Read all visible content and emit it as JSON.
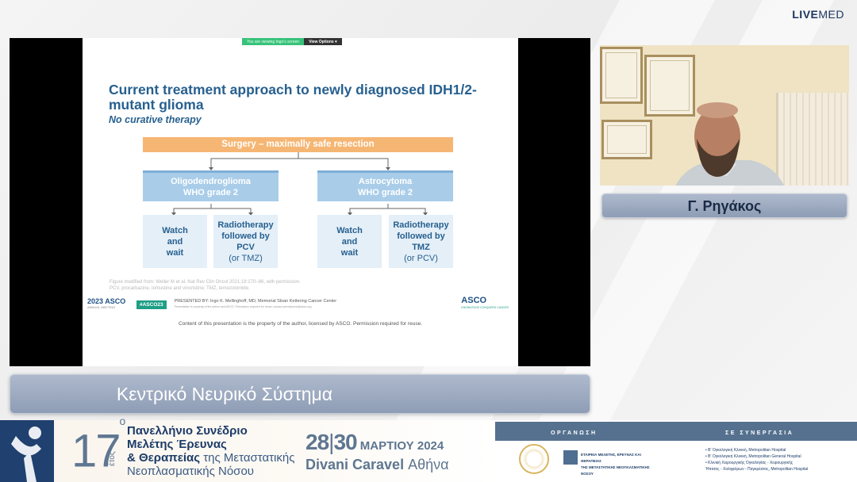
{
  "brand": {
    "live": "LIVE",
    "med": "MED"
  },
  "slide": {
    "viewing_notice": "You are viewing Ingo's screen",
    "view_options": "View Options ▾",
    "title": "Current treatment approach to newly diagnosed IDH1/2-mutant glioma",
    "subtitle": "No curative therapy",
    "surgery": "Surgery – maximally safe resection",
    "types": [
      {
        "line1": "Oligodendroglioma",
        "line2": "WHO grade 2"
      },
      {
        "line1": "Astrocytoma",
        "line2": "WHO grade 2"
      }
    ],
    "options": [
      {
        "l1": "Watch",
        "l2": "and",
        "l3": "wait",
        "l4": ""
      },
      {
        "l1": "Radiotherapy",
        "l2": "followed by",
        "l3": "PCV",
        "l4": "(or TMZ)"
      },
      {
        "l1": "Watch",
        "l2": "and",
        "l3": "wait",
        "l4": ""
      },
      {
        "l1": "Radiotherapy",
        "l2": "followed by",
        "l3": "TMZ",
        "l4": "(or PCV)"
      }
    ],
    "footnote_1": "Figure modified from: Weller M et al. Nat Rev Clin Oncol 2021;18:170–86, with permission.",
    "footnote_2": "PCV, procarbazine, lomustine and vincristine; TMZ, temozolomide.",
    "asco_meeting": "2023 ASCO",
    "asco_meeting_sub": "ANNUAL MEETING",
    "hashtag": "#ASCO23",
    "presenter": "PRESENTED BY: Ingo K. Mellinghoff, MD, Memorial Sloan Kettering Cancer Center",
    "presenter_sub": "Presentation is property of the author and ASCO. Permission required for reuse; contact permissions@asco.org",
    "asco_logo": "ASCO",
    "asco_logo_sub": "KNOWLEDGE CONQUERS CANCER",
    "copyright": "Content of this presentation is the property of the author, licensed by ASCO. Permission required for reuse."
  },
  "speaker_name": "Γ. Ρηγάκος",
  "session_topic": "Κεντρικό Νευρικό Σύστημα",
  "footer": {
    "number": "17",
    "number_suffix": "ο",
    "etos": "έτος",
    "title_lines": [
      "Πανελλήνιο Συνέδριο",
      "Μελέτης Έρευνας"
    ],
    "title_line3_bold": "& Θεραπείας",
    "title_line3_light": " της Μεταστατικής",
    "title_line4": "Νεοπλασματικής Νόσου",
    "date_d1": "28",
    "date_d2": "30",
    "date_month": " ΜΑΡΤΙΟΥ 2024",
    "venue_bold": "Divani Caravel",
    "venue_city": " Αθήνα",
    "organization_label": "ΟΡΓΑΝΩΣΗ",
    "collaboration_label": "ΣΕ ΣΥΝΕΡΓΑΣΙΑ",
    "org_name_1": "ΕΤΑΙΡΕΙΑ ΜΕΛΕΤΗΣ, ΕΡΕΥΝΑΣ ΚΑΙ ΘΕΡΑΠΕΙΑΣ",
    "org_name_2": "ΤΗΣ ΜΕΤΑΣΤΑΤΙΚΗΣ ΝΕΟΠΛΑΣΜΑΤΙΚΗΣ ΝΟΣΟΥ",
    "collaborators": [
      "• Β' Ογκολογική Κλινική, Metropolitan Hospital",
      "• Β' Ογκολογική Κλινική, Metropolitan General Hospital",
      "• Κλινική Χειρουργικής Ογκολογίας - Χειρουργικής",
      "  Ήπατος - Χοληφόρων - Παγκρέατος, Metropolitan Hospital"
    ]
  },
  "colors": {
    "accent_blue": "#27608f",
    "box_blue": "#a9cde9",
    "box_orange": "#f6b673",
    "plate": "#9aa8bf"
  }
}
